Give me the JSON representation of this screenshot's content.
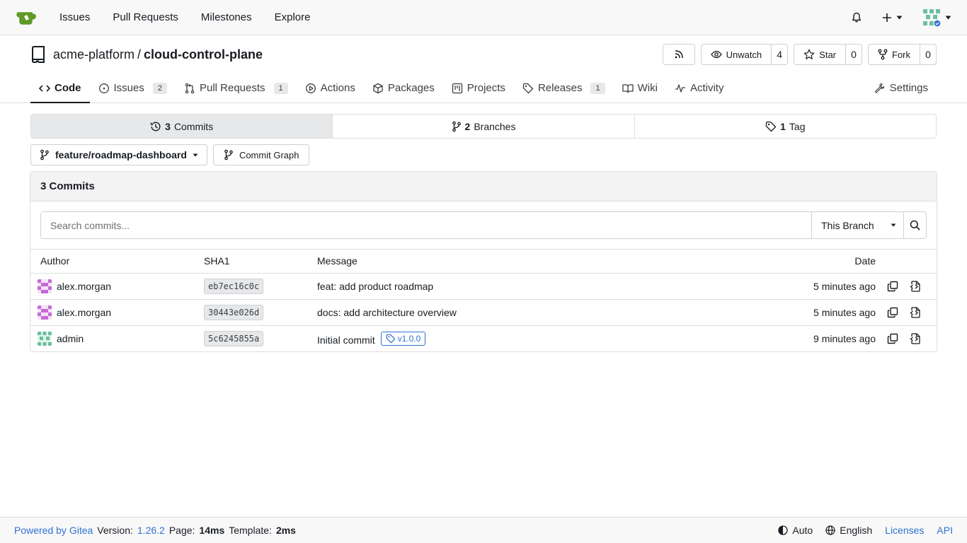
{
  "topnav": {
    "links": [
      "Issues",
      "Pull Requests",
      "Milestones",
      "Explore"
    ],
    "colors": {
      "logo": "#609926",
      "avatar": "#6bbf9e"
    }
  },
  "repo": {
    "owner": "acme-platform",
    "separator": "/",
    "name": "cloud-control-plane",
    "unwatch_label": "Unwatch",
    "watch_count": "4",
    "star_label": "Star",
    "star_count": "0",
    "fork_label": "Fork",
    "fork_count": "0"
  },
  "tabs": [
    {
      "label": "Code",
      "icon": "code-icon"
    },
    {
      "label": "Issues",
      "badge": "2",
      "icon": "issue-icon"
    },
    {
      "label": "Pull Requests",
      "badge": "1",
      "icon": "pull-request-icon"
    },
    {
      "label": "Actions",
      "icon": "play-icon"
    },
    {
      "label": "Packages",
      "icon": "package-icon"
    },
    {
      "label": "Projects",
      "icon": "project-icon"
    },
    {
      "label": "Releases",
      "badge": "1",
      "icon": "tag-icon"
    },
    {
      "label": "Wiki",
      "icon": "book-icon"
    },
    {
      "label": "Activity",
      "icon": "pulse-icon"
    },
    {
      "label": "Settings",
      "icon": "tools-icon"
    }
  ],
  "stats": {
    "commits_num": "3",
    "commits_label": "Commits",
    "branches_num": "2",
    "branches_label": "Branches",
    "tags_num": "1",
    "tags_label": "Tag"
  },
  "branch": {
    "current": "feature/roadmap-dashboard",
    "graph_label": "Commit Graph"
  },
  "commits": {
    "heading": "3 Commits",
    "search_placeholder": "Search commits...",
    "scope": "This Branch",
    "columns": {
      "author": "Author",
      "sha": "SHA1",
      "message": "Message",
      "date": "Date"
    },
    "rows": [
      {
        "author": "alex.morgan",
        "sha": "eb7ec16c0c",
        "message": "feat: add product roadmap",
        "date": "5 minutes ago"
      },
      {
        "author": "alex.morgan",
        "sha": "30443e026d",
        "message": "docs: add architecture overview",
        "date": "5 minutes ago"
      },
      {
        "author": "admin",
        "sha": "5c6245855a",
        "message": "Initial commit",
        "tag": "v1.0.0",
        "date": "9 minutes ago"
      }
    ]
  },
  "footer": {
    "powered": "Powered by Gitea",
    "version_label": "Version:",
    "version": "1.26.2",
    "page_label": "Page:",
    "page_time": "14ms",
    "template_label": "Template:",
    "template_time": "2ms",
    "theme": "Auto",
    "language": "English",
    "licenses": "Licenses",
    "api": "API"
  }
}
